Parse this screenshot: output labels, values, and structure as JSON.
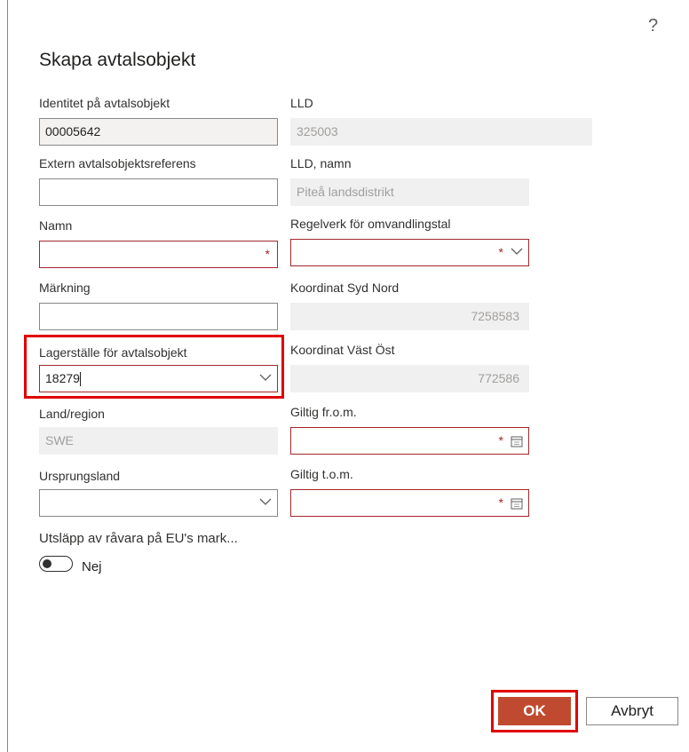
{
  "header": {
    "title": "Skapa avtalsobjekt",
    "help": "?"
  },
  "fields": {
    "identitet": {
      "label": "Identitet på avtalsobjekt",
      "value": "00005642"
    },
    "lld": {
      "label": "LLD",
      "value": "325003"
    },
    "extern_ref": {
      "label": "Extern avtalsobjektsreferens",
      "value": ""
    },
    "lld_namn": {
      "label": "LLD, namn",
      "value": "Piteå landsdistrikt"
    },
    "namn": {
      "label": "Namn",
      "value": "",
      "required": "*"
    },
    "regelverk": {
      "label": "Regelverk för omvandlingstal",
      "value": "",
      "required": "*"
    },
    "markning": {
      "label": "Märkning",
      "value": ""
    },
    "koord_sn": {
      "label": "Koordinat Syd Nord",
      "value": "7258583"
    },
    "lagerstalle": {
      "label": "Lagerställe för avtalsobjekt",
      "value": "18279"
    },
    "koord_vo": {
      "label": "Koordinat Väst Öst",
      "value": "772586"
    },
    "land": {
      "label": "Land/region",
      "value": "SWE"
    },
    "giltig_from": {
      "label": "Giltig fr.o.m.",
      "value": "",
      "required": "*"
    },
    "ursprungsland": {
      "label": "Ursprungsland",
      "value": ""
    },
    "giltig_tom": {
      "label": "Giltig t.o.m.",
      "value": "",
      "required": "*"
    },
    "utslapp": {
      "label": "Utsläpp av råvara på EU's mark...",
      "toggle_text": "Nej"
    }
  },
  "buttons": {
    "ok": "OK",
    "cancel": "Avbryt"
  },
  "colors": {
    "required_border": "#a4262c",
    "primary": "#c04a2f",
    "highlight": "#e00000"
  },
  "icons": {
    "dropdown": "chevron-down-icon",
    "date": "calendar-icon",
    "help": "help-icon"
  }
}
